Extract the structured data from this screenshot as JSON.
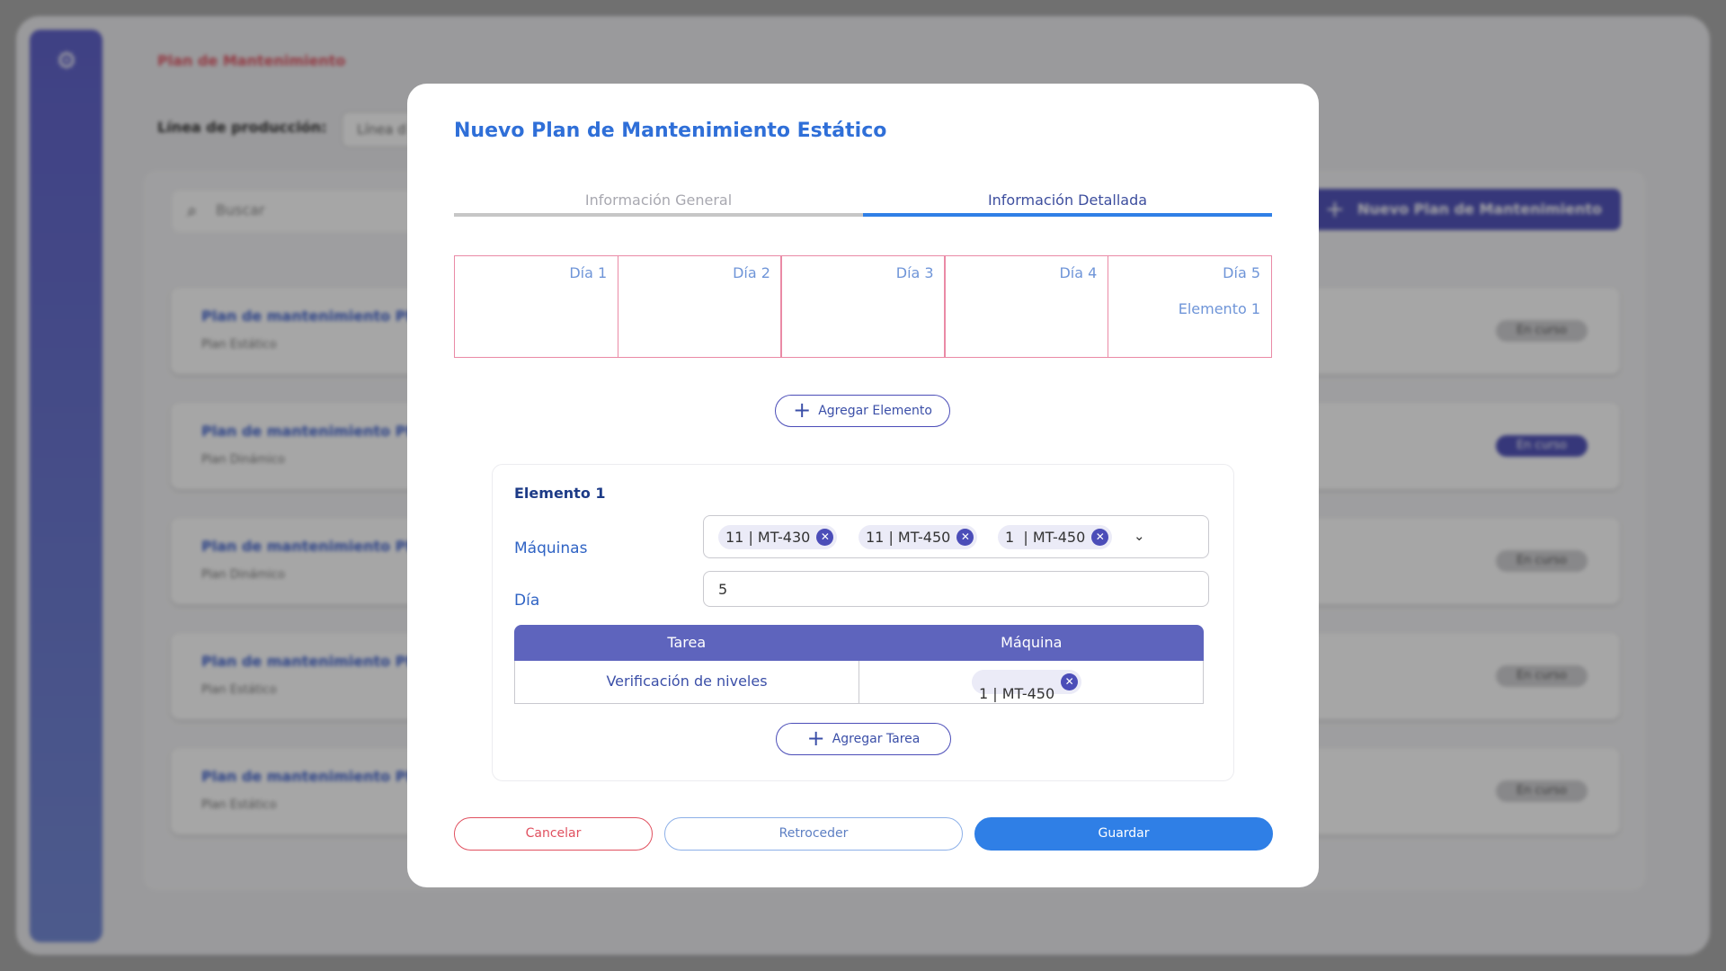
{
  "background": {
    "breadcrumb": "Plan de Mantenimiento",
    "line_label": "Línea de producción:",
    "line_select_value": "Línea d",
    "search_placeholder": "Buscar",
    "new_plan_label": "Nuevo Plan de Mantenimiento",
    "cards": [
      {
        "title": "Plan de mantenimiento PM",
        "subtitle": "Plan Estático",
        "status": "En curso"
      },
      {
        "title": "Plan de mantenimiento PM",
        "subtitle": "Plan Dinámico",
        "status": "En curso"
      },
      {
        "title": "Plan de mantenimiento PM",
        "subtitle": "Plan Dinámico",
        "status": "En curso"
      },
      {
        "title": "Plan de mantenimiento PM",
        "subtitle": "Plan Estático",
        "status": "En curso"
      },
      {
        "title": "Plan de mantenimiento PM",
        "subtitle": "Plan Estático",
        "status": "En curso"
      }
    ]
  },
  "modal": {
    "title": "Nuevo Plan de Mantenimiento Estático",
    "tabs": [
      {
        "label": "Información General",
        "active": false
      },
      {
        "label": "Información Detallada",
        "active": true
      }
    ],
    "days": [
      {
        "label": "Día 1",
        "element": ""
      },
      {
        "label": "Día 2",
        "element": ""
      },
      {
        "label": "Día 3",
        "element": ""
      },
      {
        "label": "Día 4",
        "element": ""
      },
      {
        "label": "Día 5",
        "element": "Elemento 1"
      }
    ],
    "add_element_label": "Agregar Elemento",
    "element": {
      "title": "Elemento 1",
      "machines_label": "Máquinas",
      "machines": [
        "11 | MT-430",
        "11 | MT-450",
        "1  | MT-450"
      ],
      "day_label": "Día",
      "day_value": "5",
      "table": {
        "headers": [
          "Tarea",
          "Máquina"
        ],
        "rows": [
          {
            "task": "Verificación de niveles",
            "machine": "1 | MT-450"
          }
        ]
      },
      "add_task_label": "Agregar Tarea"
    },
    "buttons": {
      "cancel": "Cancelar",
      "back": "Retroceder",
      "save": "Guardar"
    }
  },
  "colors": {
    "primary": "#2f7fe6",
    "accent": "#4b4db8",
    "danger": "#e0505f",
    "day_border": "#ea8aa6"
  }
}
